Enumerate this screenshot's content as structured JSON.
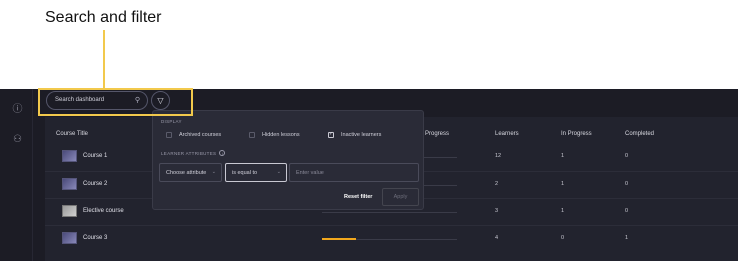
{
  "annotation": {
    "label": "Search and filter"
  },
  "search": {
    "placeholder": "Search dashboard",
    "icon": "search-icon"
  },
  "filter_button": {
    "icon": "filter-icon"
  },
  "table": {
    "columns": [
      "Course Title",
      "Progress",
      "Learners",
      "In Progress",
      "Completed"
    ],
    "rows": [
      {
        "title": "Course 1",
        "learners": "12",
        "in_progress": "1",
        "completed": "0"
      },
      {
        "title": "Course 2",
        "learners": "2",
        "in_progress": "1",
        "completed": "0"
      },
      {
        "title": "Elective course",
        "learners": "3",
        "in_progress": "1",
        "completed": "0"
      },
      {
        "title": "Course 3",
        "learners": "4",
        "in_progress": "0",
        "completed": "1",
        "progress_fraction": 0.25
      }
    ]
  },
  "filter_popup": {
    "display_label": "DISPLAY",
    "checkboxes": [
      {
        "label": "Archived courses",
        "checked": false
      },
      {
        "label": "Hidden lessons",
        "checked": false
      },
      {
        "label": "Inactive learners",
        "checked": true
      }
    ],
    "learner_attributes_label": "LEARNER ATTRIBUTES",
    "attribute_select": "Choose attribute",
    "operator_select": "is equal to",
    "value_placeholder": "Enter value",
    "reset_label": "Reset filter",
    "apply_label": "Apply"
  },
  "colors": {
    "accent": "#f2c94c",
    "progress": "#f2a81d",
    "background": "#1c1c25"
  }
}
